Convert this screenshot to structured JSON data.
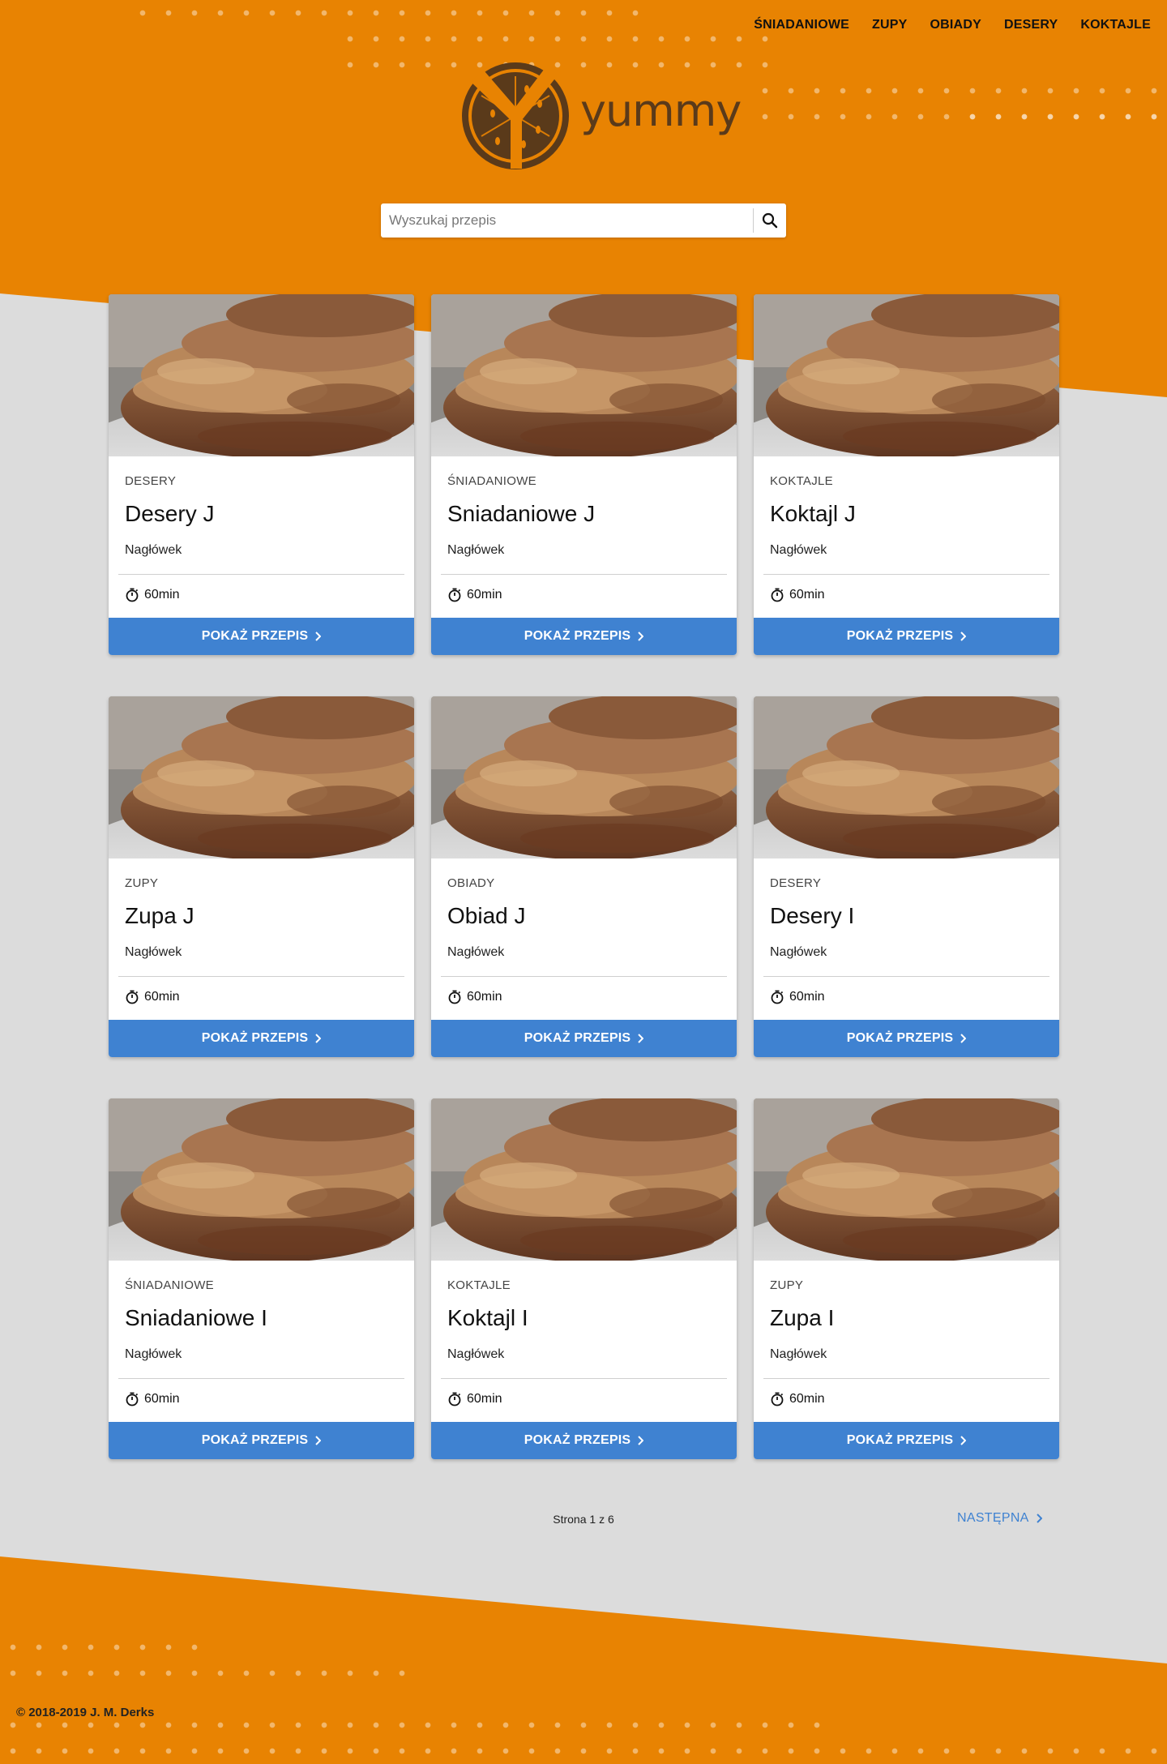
{
  "nav": {
    "items": [
      "ŚNIADANIOWE",
      "ZUPY",
      "OBIADY",
      "DESERY",
      "KOKTAJLE"
    ]
  },
  "logo": {
    "text": "yummy",
    "icon": "orange-slice-y-icon"
  },
  "search": {
    "placeholder": "Wyszukaj przepis",
    "icon": "search-icon"
  },
  "cards": [
    {
      "category": "DESERY",
      "title": "Desery J",
      "subtitle": "Nagłówek",
      "time": "60min",
      "button": "POKAŻ PRZEPIS"
    },
    {
      "category": "ŚNIADANIOWE",
      "title": "Sniadaniowe J",
      "subtitle": "Nagłówek",
      "time": "60min",
      "button": "POKAŻ PRZEPIS"
    },
    {
      "category": "KOKTAJLE",
      "title": "Koktajl J",
      "subtitle": "Nagłówek",
      "time": "60min",
      "button": "POKAŻ PRZEPIS"
    },
    {
      "category": "ZUPY",
      "title": "Zupa J",
      "subtitle": "Nagłówek",
      "time": "60min",
      "button": "POKAŻ PRZEPIS"
    },
    {
      "category": "OBIADY",
      "title": "Obiad J",
      "subtitle": "Nagłówek",
      "time": "60min",
      "button": "POKAŻ PRZEPIS"
    },
    {
      "category": "DESERY",
      "title": "Desery I",
      "subtitle": "Nagłówek",
      "time": "60min",
      "button": "POKAŻ PRZEPIS"
    },
    {
      "category": "ŚNIADANIOWE",
      "title": "Sniadaniowe I",
      "subtitle": "Nagłówek",
      "time": "60min",
      "button": "POKAŻ PRZEPIS"
    },
    {
      "category": "KOKTAJLE",
      "title": "Koktajl I",
      "subtitle": "Nagłówek",
      "time": "60min",
      "button": "POKAŻ PRZEPIS"
    },
    {
      "category": "ZUPY",
      "title": "Zupa I",
      "subtitle": "Nagłówek",
      "time": "60min",
      "button": "POKAŻ PRZEPIS"
    }
  ],
  "pagination": {
    "info": "Strona 1 z 6",
    "next": "NASTĘPNA"
  },
  "footer": {
    "copyright": "© 2018-2019 J. M. Derks"
  },
  "colors": {
    "accent": "#e88302",
    "button": "#3f82d1",
    "background": "#dcdcdc",
    "logo": "#5a3a1a"
  }
}
